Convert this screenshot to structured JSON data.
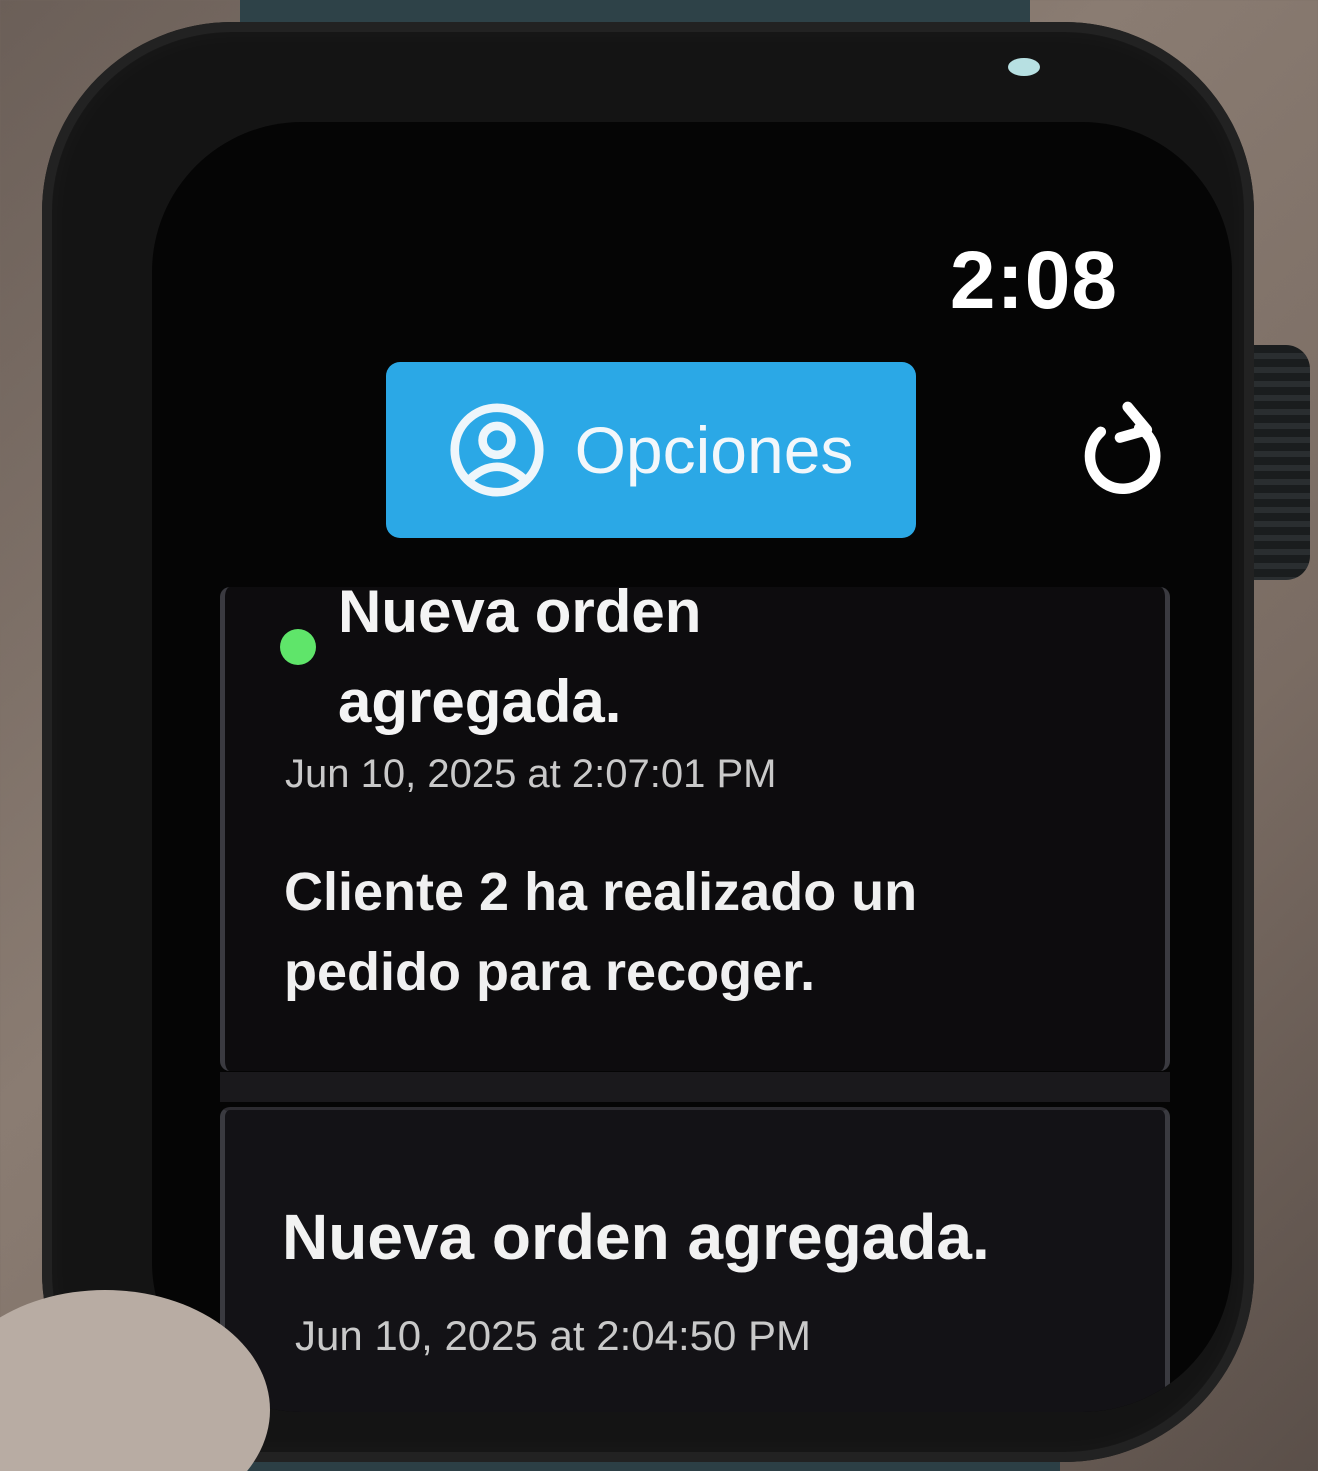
{
  "status": {
    "time": "2:08"
  },
  "toolbar": {
    "options_label": "Opciones",
    "options_icon": "person-circle-icon",
    "refresh_icon": "refresh-icon",
    "accent_color": "#2ba8e6"
  },
  "notifications": [
    {
      "title": "Nueva orden agregada.",
      "date": "Jun 10, 2025 at 2:07:01 PM",
      "body": "Cliente 2 ha realizado un pedido para recoger.",
      "unread": true,
      "unread_color": "#5fe56a"
    },
    {
      "title": "Nueva orden agregada.",
      "date": "Jun 10, 2025 at 2:04:50 PM"
    }
  ]
}
